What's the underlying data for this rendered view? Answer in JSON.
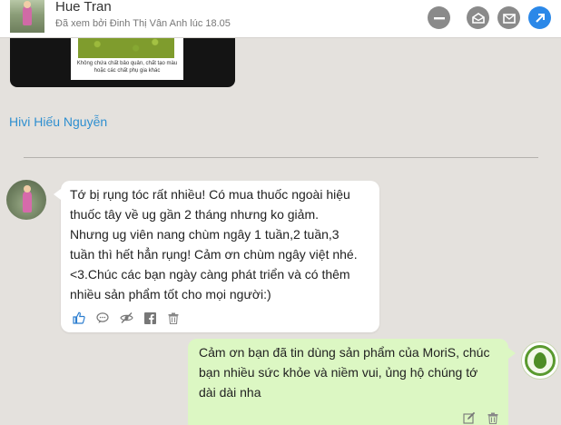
{
  "header": {
    "name": "Hue Tran",
    "seen_status": "Đã xem bởi Đinh Thị Vân Anh lúc 18.05",
    "buttons": {
      "minimize": "minus-icon",
      "mail": "envelope-open-icon",
      "mail_all": "envelope-icon",
      "open": "external-link-icon"
    },
    "colors": {
      "button_gray": "#8a8a8a",
      "button_blue": "#2b88e8"
    }
  },
  "image_post": {
    "caption": "Không chứa chất bảo quản, chất tạo màu hoặc các chất phụ gia khác"
  },
  "mention": "Hivi Hiếu Nguyễn",
  "messages": [
    {
      "side": "left",
      "text": "Tớ bị rụng tóc rất nhiều! Có mua thuốc ngoài hiệu thuốc tây về ug gần 2 tháng nhưng ko giảm. Nhưng ug viên nang chùm ngây 1 tuần,2 tuần,3 tuần thì hết hẳn rụng! Cảm ơn chùm ngây việt nhé. <3.Chúc các bạn ngày càng phát triển và có thêm nhiều sản phẩm tốt cho mọi người:)",
      "actions": [
        "like-icon",
        "comment-icon",
        "hide-icon",
        "facebook-icon",
        "trash-icon"
      ]
    },
    {
      "side": "right",
      "text": "Cảm ơn bạn đã tin dùng sản phẩm của MoriS, chúc bạn nhiều sức khỏe và niềm vui, ủng hộ chúng tớ dài dài nha",
      "actions": [
        "edit-icon",
        "trash-icon"
      ]
    }
  ],
  "colors": {
    "background": "#e4e1dd",
    "left_bubble": "#ffffff",
    "right_bubble": "#dcf7c3",
    "link": "#2e8fd0",
    "like_blue": "#2e7fd0"
  }
}
